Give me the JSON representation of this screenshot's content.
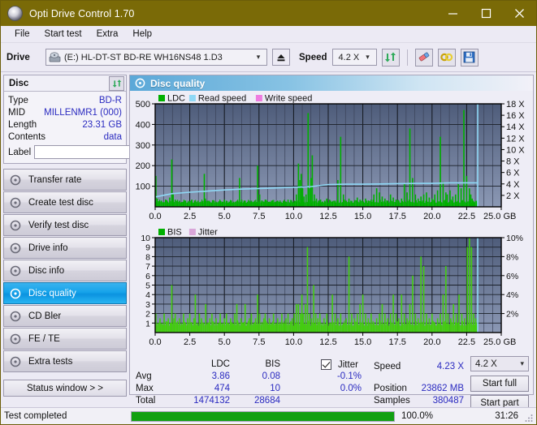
{
  "window": {
    "title": "Opti Drive Control 1.70",
    "icon": "disc-icon",
    "minimize": "minimize",
    "maximize": "maximize",
    "close": "close"
  },
  "menu": {
    "items": [
      "File",
      "Start test",
      "Extra",
      "Help"
    ]
  },
  "toolbar": {
    "drive_label": "Drive",
    "drive_value": "(E:)  HL-DT-ST BD-RE  WH16NS48 1.D3",
    "eject_icon": "eject-icon",
    "speed_label": "Speed",
    "speed_value": "4.2 X",
    "refresh_icon": "refresh-icon",
    "erase_icon": "eraser-icon",
    "settings_icon": "plug-icon",
    "save_icon": "save-icon"
  },
  "disc_panel": {
    "title": "Disc",
    "refresh_icon": "refresh-icon",
    "rows": [
      {
        "key": "Type",
        "value": "BD-R"
      },
      {
        "key": "MID",
        "value": "MILLENMR1 (000)"
      },
      {
        "key": "Length",
        "value": "23.31 GB"
      },
      {
        "key": "Contents",
        "value": "data"
      }
    ],
    "label_key": "Label",
    "label_value": "",
    "label_button_icon": "disc-icon"
  },
  "sidebar": {
    "items": [
      {
        "label": "Transfer rate",
        "icon": "disc-icon",
        "active": false
      },
      {
        "label": "Create test disc",
        "icon": "disc-icon",
        "active": false
      },
      {
        "label": "Verify test disc",
        "icon": "disc-icon",
        "active": false
      },
      {
        "label": "Drive info",
        "icon": "disc-icon",
        "active": false
      },
      {
        "label": "Disc info",
        "icon": "disc-icon",
        "active": false
      },
      {
        "label": "Disc quality",
        "icon": "disc-icon",
        "active": true
      },
      {
        "label": "CD Bler",
        "icon": "disc-icon",
        "active": false
      },
      {
        "label": "FE / TE",
        "icon": "disc-icon",
        "active": false
      },
      {
        "label": "Extra tests",
        "icon": "disc-icon",
        "active": false
      }
    ],
    "status_button": "Status window > >"
  },
  "main": {
    "title": "Disc quality",
    "icon": "disc-icon"
  },
  "stats": {
    "col_ldc": "LDC",
    "col_bis": "BIS",
    "row_avg": "Avg",
    "row_max": "Max",
    "row_total": "Total",
    "avg_ldc": "3.86",
    "avg_bis": "0.08",
    "max_ldc": "474",
    "max_bis": "10",
    "total_ldc": "1474132",
    "total_bis": "28684",
    "jitter_label": "Jitter",
    "jitter_checked": true,
    "jitter_avg": "-0.1%",
    "jitter_max": "0.0%",
    "speed_label": "Speed",
    "speed_value": "4.23 X",
    "position_label": "Position",
    "position_value": "23862 MB",
    "samples_label": "Samples",
    "samples_value": "380487",
    "speed_select": "4.2 X",
    "start_full": "Start full",
    "start_part": "Start part"
  },
  "statusbar": {
    "text": "Test completed",
    "progress_pct": 100.0,
    "progress_label": "100.0%",
    "elapsed": "31:26"
  },
  "colors": {
    "titlebar": "#7a6a07",
    "accent_blue": "#0b93e0",
    "value_text": "#2b2bc0",
    "ldc_green": "#00b000",
    "bis_green": "#44cc11",
    "read_speed": "#8fd8f5",
    "write_speed": "#ee7ce0",
    "jitter": "#d9a6d9",
    "plot_bg_top": "#4e5c7a",
    "plot_bg_bottom": "#8b98b4",
    "progress_green": "#11a011"
  },
  "chart_data": [
    {
      "type": "bar",
      "name": "ldc-chart",
      "title": "",
      "legend": [
        {
          "label": "LDC",
          "color": "#00b000"
        },
        {
          "label": "Read speed",
          "color": "#8fd8f5"
        },
        {
          "label": "Write speed",
          "color": "#ee7ce0"
        }
      ],
      "legend_position": "top-left",
      "grid": true,
      "xlabel": "GB",
      "ylabel": "LDC",
      "xlim": [
        0,
        25
      ],
      "ylim": [
        0,
        500
      ],
      "xticks": [
        0.0,
        2.5,
        5.0,
        7.5,
        10.0,
        12.5,
        15.0,
        17.5,
        20.0,
        22.5,
        25.0
      ],
      "xticklabels": [
        "0.0",
        "2.5",
        "5.0",
        "7.5",
        "10.0",
        "12.5",
        "15.0",
        "17.5",
        "20.0",
        "22.5",
        "25.0 GB"
      ],
      "yticks": [
        100,
        200,
        300,
        400,
        500
      ],
      "y2label": "Speed",
      "y2lim": [
        0,
        18
      ],
      "y2ticks": [
        2,
        4,
        6,
        8,
        10,
        12,
        14,
        16,
        18
      ],
      "y2ticklabels": [
        "2 X",
        "4 X",
        "6 X",
        "8 X",
        "10 X",
        "12 X",
        "14 X",
        "16 X",
        "18 X"
      ],
      "data_end_x": 23.3,
      "series": [
        {
          "name": "LDC",
          "color": "#00b000",
          "x": [
            0.05,
            0.15,
            0.3,
            0.45,
            0.6,
            0.75,
            0.9,
            1.05,
            1.2,
            1.3,
            1.45,
            1.6,
            1.75,
            1.9,
            2.05,
            2.2,
            2.35,
            2.5,
            2.65,
            2.8,
            2.95,
            3.1,
            3.25,
            3.4,
            3.55,
            3.62,
            3.8,
            3.95,
            4.1,
            4.25,
            4.4,
            4.55,
            4.7,
            4.85,
            5.0,
            5.2,
            5.35,
            5.5,
            5.65,
            5.8,
            5.95,
            6.1,
            6.25,
            6.4,
            6.5,
            6.65,
            6.8,
            6.95,
            7.1,
            7.25,
            7.4,
            7.55,
            7.7,
            7.85,
            7.95,
            8.1,
            8.25,
            8.4,
            8.55,
            8.7,
            8.85,
            9.0,
            9.15,
            9.3,
            9.45,
            9.6,
            9.75,
            9.9,
            10.05,
            10.2,
            10.35,
            10.45,
            10.55,
            10.65,
            10.75,
            10.9,
            11.05,
            11.15,
            11.25,
            11.35,
            11.5,
            11.65,
            11.8,
            11.95,
            12.1,
            12.25,
            12.4,
            12.6,
            12.8,
            13.0,
            13.2,
            13.4,
            13.6,
            13.8,
            14.0,
            14.2,
            14.4,
            14.6,
            14.8,
            15.0,
            15.2,
            15.4,
            15.6,
            15.8,
            16.0,
            16.2,
            16.4,
            16.6,
            16.8,
            17.0,
            17.2,
            17.4,
            17.6,
            17.8,
            18.0,
            18.2,
            18.4,
            18.6,
            18.8,
            19.0,
            19.2,
            19.4,
            19.6,
            19.8,
            20.0,
            20.2,
            20.4,
            20.6,
            20.8,
            21.0,
            21.1,
            21.3,
            21.5,
            21.7,
            21.9,
            22.1,
            22.3,
            22.5,
            22.7,
            22.8,
            22.9,
            23.0,
            23.1,
            23.2,
            23.3
          ],
          "y": [
            150,
            40,
            25,
            30,
            20,
            35,
            25,
            45,
            230,
            60,
            35,
            25,
            30,
            20,
            25,
            30,
            20,
            25,
            35,
            20,
            25,
            30,
            20,
            25,
            160,
            40,
            30,
            25,
            20,
            30,
            25,
            20,
            30,
            25,
            35,
            20,
            25,
            30,
            20,
            25,
            30,
            140,
            35,
            25,
            30,
            20,
            25,
            30,
            25,
            20,
            200,
            60,
            30,
            25,
            35,
            20,
            25,
            30,
            20,
            25,
            30,
            25,
            20,
            30,
            25,
            35,
            20,
            25,
            30,
            60,
            210,
            130,
            160,
            90,
            50,
            60,
            455,
            90,
            140,
            250,
            60,
            40,
            30,
            35,
            25,
            30,
            40,
            35,
            25,
            30,
            130,
            340,
            60,
            30,
            40,
            25,
            30,
            45,
            35,
            25,
            40,
            30,
            35,
            60,
            90,
            70,
            50,
            40,
            30,
            60,
            45,
            35,
            30,
            40,
            110,
            70,
            380,
            140,
            60,
            40,
            50,
            60,
            70,
            45,
            40,
            60,
            80,
            340,
            120,
            70,
            60,
            80,
            50,
            60,
            110,
            90,
            470,
            150,
            90,
            60,
            40,
            25
          ]
        },
        {
          "name": "Read speed",
          "color": "#8fd8f5",
          "type": "line",
          "axis": "y2",
          "x": [
            0.05,
            1.2,
            2.5,
            3.8,
            5.0,
            6.3,
            7.5,
            8.8,
            10.0,
            11.3,
            12.5,
            13.8,
            15.0,
            16.3,
            17.5,
            18.8,
            20.0,
            21.3,
            22.5,
            23.3
          ],
          "y": [
            1.75,
            2.3,
            2.55,
            2.75,
            2.95,
            3.1,
            3.2,
            3.3,
            3.4,
            3.55,
            3.9,
            3.95,
            3.95,
            4.0,
            4.05,
            4.1,
            4.1,
            4.2,
            4.2,
            4.2
          ]
        }
      ]
    },
    {
      "type": "bar",
      "name": "bis-chart",
      "title": "",
      "legend": [
        {
          "label": "BIS",
          "color": "#00b000"
        },
        {
          "label": "Jitter",
          "color": "#d9a6d9"
        }
      ],
      "legend_position": "top-left",
      "grid": true,
      "xlabel": "GB",
      "ylabel": "BIS",
      "xlim": [
        0,
        25
      ],
      "ylim": [
        0,
        10
      ],
      "xticks": [
        0.0,
        2.5,
        5.0,
        7.5,
        10.0,
        12.5,
        15.0,
        17.5,
        20.0,
        22.5,
        25.0
      ],
      "xticklabels": [
        "0.0",
        "2.5",
        "5.0",
        "7.5",
        "10.0",
        "12.5",
        "15.0",
        "17.5",
        "20.0",
        "22.5",
        "25.0 GB"
      ],
      "yticks": [
        1,
        2,
        3,
        4,
        5,
        6,
        7,
        8,
        9,
        10
      ],
      "y2label": "Jitter",
      "y2lim": [
        0,
        10
      ],
      "y2ticks": [
        2,
        4,
        6,
        8,
        10
      ],
      "y2ticklabels": [
        "2%",
        "4%",
        "6%",
        "8%",
        "10%"
      ],
      "data_end_x": 23.3,
      "series": [
        {
          "name": "BIS",
          "color": "#44cc11",
          "x": [
            0.05,
            0.2,
            0.35,
            0.5,
            0.65,
            0.8,
            0.95,
            1.1,
            1.2,
            1.35,
            1.45,
            1.6,
            1.75,
            1.9,
            2.05,
            2.2,
            2.35,
            2.5,
            2.65,
            2.8,
            2.9,
            3.05,
            3.2,
            3.35,
            3.5,
            3.65,
            3.8,
            3.95,
            4.1,
            4.25,
            4.4,
            4.55,
            4.7,
            4.85,
            5.0,
            5.15,
            5.3,
            5.45,
            5.6,
            5.75,
            5.9,
            6.05,
            6.2,
            6.35,
            6.5,
            6.65,
            6.8,
            6.95,
            7.1,
            7.25,
            7.4,
            7.55,
            7.7,
            7.85,
            7.95,
            8.1,
            8.25,
            8.4,
            8.55,
            8.7,
            8.85,
            9.0,
            9.15,
            9.3,
            9.45,
            9.6,
            9.75,
            9.9,
            10.05,
            10.2,
            10.35,
            10.5,
            10.6,
            10.7,
            10.85,
            11.0,
            11.15,
            11.3,
            11.45,
            11.6,
            11.75,
            11.9,
            12.05,
            12.2,
            12.4,
            12.6,
            12.8,
            13.0,
            13.2,
            13.4,
            13.6,
            13.8,
            14.0,
            14.2,
            14.4,
            14.6,
            14.8,
            15.0,
            15.2,
            15.4,
            15.6,
            15.8,
            16.0,
            16.2,
            16.4,
            16.6,
            16.8,
            17.0,
            17.2,
            17.4,
            17.6,
            17.8,
            18.0,
            18.2,
            18.4,
            18.6,
            18.8,
            19.0,
            19.2,
            19.4,
            19.6,
            19.8,
            20.0,
            20.2,
            20.4,
            20.6,
            20.8,
            21.0,
            21.15,
            21.35,
            21.55,
            21.75,
            21.95,
            22.15,
            22.35,
            22.55,
            22.7,
            22.85,
            23.0,
            23.15,
            23.3
          ],
          "y": [
            2,
            1,
            1.5,
            1,
            2,
            1,
            1.5,
            1,
            5,
            1.5,
            2,
            1,
            1.5,
            1,
            2,
            1,
            1.5,
            2,
            1,
            1.5,
            4,
            1,
            2,
            1.5,
            1,
            3,
            1,
            1.5,
            2,
            1,
            1.5,
            1,
            2,
            1,
            1.5,
            2,
            1,
            1.5,
            1,
            2,
            3,
            1,
            1.5,
            1,
            3,
            1,
            1.5,
            2,
            1,
            1.5,
            4,
            2,
            1,
            1.5,
            2,
            1,
            1.5,
            1,
            2,
            1,
            1.5,
            1,
            2,
            1,
            1.5,
            2,
            1,
            1.5,
            2,
            3,
            3,
            2,
            4,
            2,
            3,
            9,
            2,
            1.5,
            5,
            2,
            1.5,
            2,
            1,
            1.5,
            2,
            1,
            4,
            2,
            1.5,
            2,
            1,
            1.5,
            8,
            2,
            1.5,
            2,
            3,
            4,
            2,
            1.5,
            2,
            1,
            1.5,
            2,
            3,
            2,
            1.5,
            2,
            4,
            2,
            1.5,
            4,
            2,
            1.5,
            3,
            6,
            2,
            1.5,
            8,
            7,
            2,
            1.5,
            2,
            1,
            1.5,
            2,
            4,
            7,
            2,
            1.5,
            3,
            2,
            4,
            2,
            1.5,
            9,
            10,
            9,
            2,
            1.5
          ]
        }
      ]
    }
  ]
}
